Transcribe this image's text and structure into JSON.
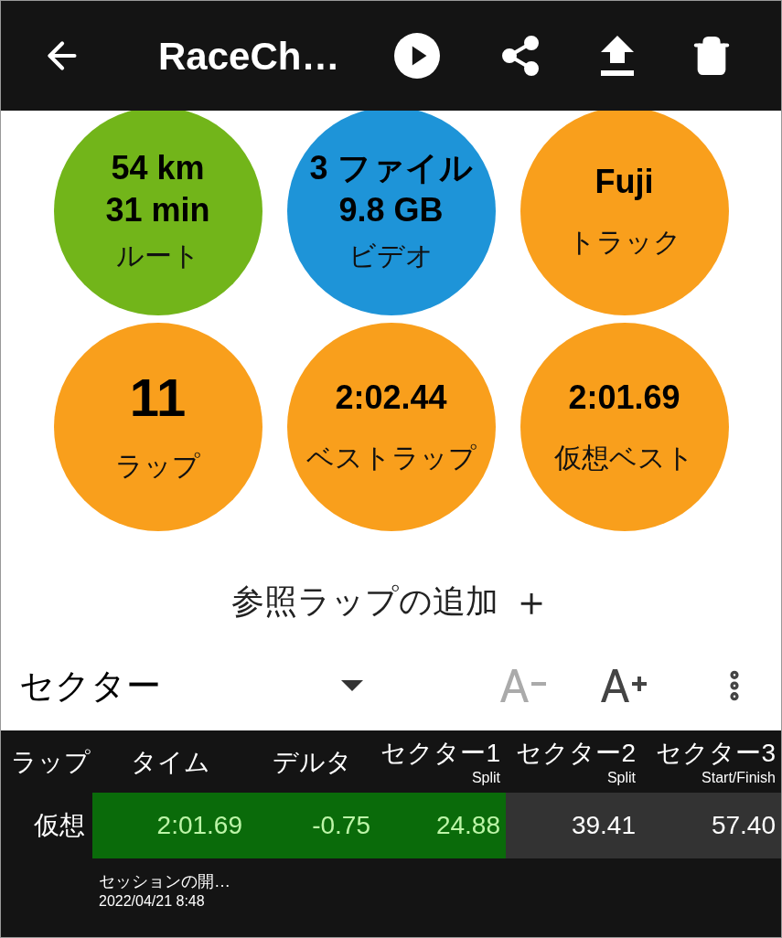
{
  "app_bar": {
    "title": "RaceCh…"
  },
  "stats": [
    {
      "lines": [
        "54 km",
        "31 min"
      ],
      "label": "ルート",
      "color": "#72b51a"
    },
    {
      "lines": [
        "3 ファイル",
        "9.8 GB"
      ],
      "label": "ビデオ",
      "color": "#1e94d8"
    },
    {
      "lines": [
        "Fuji"
      ],
      "label": "トラック",
      "color": "#f99f1c"
    },
    {
      "lines": [
        "11"
      ],
      "label": "ラップ",
      "color": "#f99f1c",
      "large": true
    },
    {
      "lines": [
        "2:02.44"
      ],
      "label": "ベストラップ",
      "color": "#f99f1c"
    },
    {
      "lines": [
        "2:01.69"
      ],
      "label": "仮想ベスト",
      "color": "#f99f1c"
    }
  ],
  "add_reference": {
    "label": "参照ラップの追加",
    "icon": "＋"
  },
  "toolbar": {
    "selector": "セクター",
    "font_smaller_disabled": true,
    "font_larger_disabled": false
  },
  "table": {
    "columns": [
      {
        "label": "ラップ"
      },
      {
        "label": "タイム"
      },
      {
        "label": "デルタ"
      },
      {
        "label": "セクター1",
        "sub": "Split"
      },
      {
        "label": "セクター2",
        "sub": "Split"
      },
      {
        "label": "セクター3",
        "sub": "Start/Finish"
      }
    ],
    "rows": [
      {
        "cells": [
          {
            "text": "仮想",
            "kind": "label"
          },
          {
            "text": "2:01.69",
            "highlight": true
          },
          {
            "text": "-0.75",
            "highlight": true
          },
          {
            "text": "24.88",
            "highlight": true
          },
          {
            "text": "39.41",
            "highlight": false
          },
          {
            "text": "57.40",
            "highlight": false
          }
        ]
      }
    ],
    "session": {
      "title": "セッションの開…",
      "date": "2022/04/21 8:48"
    }
  }
}
